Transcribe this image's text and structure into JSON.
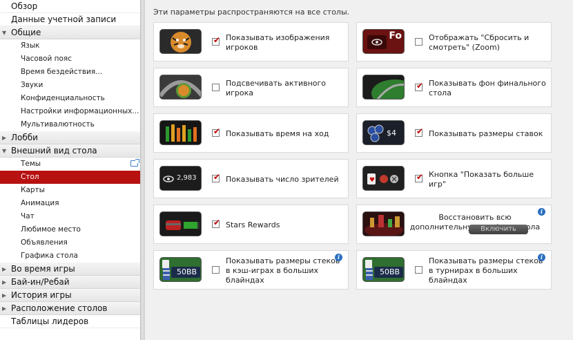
{
  "sidebar": {
    "items": [
      {
        "label": "Обзор",
        "kind": "top"
      },
      {
        "label": "Данные учетной записи",
        "kind": "top"
      },
      {
        "label": "Общие",
        "kind": "group",
        "expanded": true
      },
      {
        "label": "Язык",
        "kind": "sub"
      },
      {
        "label": "Часовой пояс",
        "kind": "sub"
      },
      {
        "label": "Время бездействия...",
        "kind": "sub"
      },
      {
        "label": "Звуки",
        "kind": "sub"
      },
      {
        "label": "Конфиденциальность",
        "kind": "sub"
      },
      {
        "label": "Настройки информационных...",
        "kind": "sub"
      },
      {
        "label": "Мультивалютность",
        "kind": "sub"
      },
      {
        "label": "Лобби",
        "kind": "group",
        "expanded": false
      },
      {
        "label": "Внешний вид стола",
        "kind": "group",
        "expanded": true
      },
      {
        "label": "Темы",
        "kind": "sub",
        "external": true
      },
      {
        "label": "Стол",
        "kind": "sub",
        "selected": true
      },
      {
        "label": "Карты",
        "kind": "sub"
      },
      {
        "label": "Анимация",
        "kind": "sub"
      },
      {
        "label": "Чат",
        "kind": "sub"
      },
      {
        "label": "Любимое место",
        "kind": "sub"
      },
      {
        "label": "Объявления",
        "kind": "sub"
      },
      {
        "label": "Графика стола",
        "kind": "sub"
      },
      {
        "label": "Во время игры",
        "kind": "group",
        "expanded": false
      },
      {
        "label": "Бай-ин/Ребай",
        "kind": "group",
        "expanded": false
      },
      {
        "label": "История игры",
        "kind": "group",
        "expanded": false
      },
      {
        "label": "Расположение столов",
        "kind": "group",
        "expanded": false
      },
      {
        "label": "Таблицы лидеров",
        "kind": "top"
      }
    ]
  },
  "main": {
    "intro": "Эти параметры распространяются на все столы.",
    "cards": [
      {
        "label": "Показывать изображения игроков",
        "checked": true,
        "thumb": "tiger-avatar"
      },
      {
        "label": "Отображать \"Сбросить и смотреть\" (Zoom)",
        "checked": false,
        "thumb": "fold-zoom",
        "thumb_text": "Fo"
      },
      {
        "label": "Подсвечивать активного игрока",
        "checked": false,
        "thumb": "active-player"
      },
      {
        "label": "Показывать фон финального стола",
        "checked": true,
        "thumb": "final-table-felt"
      },
      {
        "label": "Показывать время на ход",
        "checked": true,
        "thumb": "time-bank"
      },
      {
        "label": "Показывать размеры ставок",
        "checked": true,
        "thumb": "bet-chips",
        "thumb_text": "$4"
      },
      {
        "label": "Показывать число зрителей",
        "checked": true,
        "thumb": "viewers-eye",
        "thumb_text": "2,983"
      },
      {
        "label": "Кнопка \"Показать больше игр\"",
        "checked": true,
        "thumb": "more-games"
      },
      {
        "label": "Stars Rewards",
        "checked": true,
        "thumb": "rewards-chest"
      },
      {
        "label": "Восстановить всю дополнительную графику стола",
        "thumb": "table-graphics",
        "button": "Включить",
        "info": true
      },
      {
        "label": "Показывать размеры стеков в кэш-играх в больших блайндах",
        "checked": false,
        "thumb": "stack-bb",
        "thumb_text": "50BB",
        "info": true
      },
      {
        "label": "Показывать размеры стеков в турнирах в больших блайндах",
        "checked": false,
        "thumb": "stack-bb",
        "thumb_text": "50BB",
        "info": true
      }
    ]
  },
  "colors": {
    "accent": "#b71111",
    "info": "#2a6fc0",
    "panel": "#f0f0f0"
  }
}
